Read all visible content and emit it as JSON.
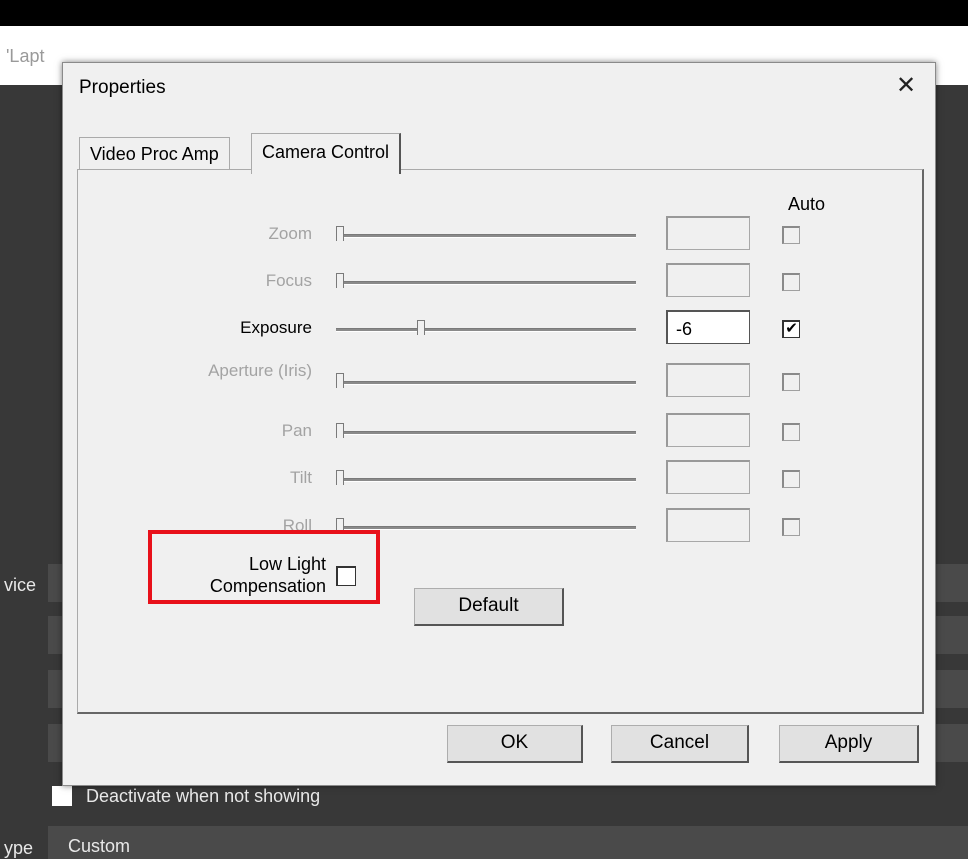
{
  "background": {
    "title_fragment": "'Lapt",
    "device_label": "vice",
    "deactivate_label": "Deactivate when not showing",
    "type_label": "ype",
    "type_value": "Custom"
  },
  "dialog": {
    "title": "Properties",
    "close_glyph": "✕",
    "tabs": [
      "Video Proc Amp",
      "Camera Control"
    ],
    "auto_header": "Auto",
    "rows": [
      {
        "label": "Zoom",
        "value": "",
        "auto": false,
        "enabled": false,
        "level": 0.0
      },
      {
        "label": "Focus",
        "value": "",
        "auto": false,
        "enabled": false,
        "level": 0.0
      },
      {
        "label": "Exposure",
        "value": "-6",
        "auto": true,
        "enabled": true,
        "level": 0.27
      },
      {
        "label": "Aperture (Iris)",
        "value": "",
        "auto": false,
        "enabled": false,
        "level": 0.0
      },
      {
        "label": "Pan",
        "value": "",
        "auto": false,
        "enabled": false,
        "level": 0.0
      },
      {
        "label": "Tilt",
        "value": "",
        "auto": false,
        "enabled": false,
        "level": 0.0
      },
      {
        "label": "Roll",
        "value": "",
        "auto": false,
        "enabled": false,
        "level": 0.0
      }
    ],
    "low_light_label": "Low Light Compensation",
    "low_light_checked": false,
    "default_button": "Default",
    "ok_button": "OK",
    "cancel_button": "Cancel",
    "apply_button": "Apply"
  },
  "colors": {
    "highlight": "#e8101a",
    "disabled_text": "#a3a3a3"
  }
}
